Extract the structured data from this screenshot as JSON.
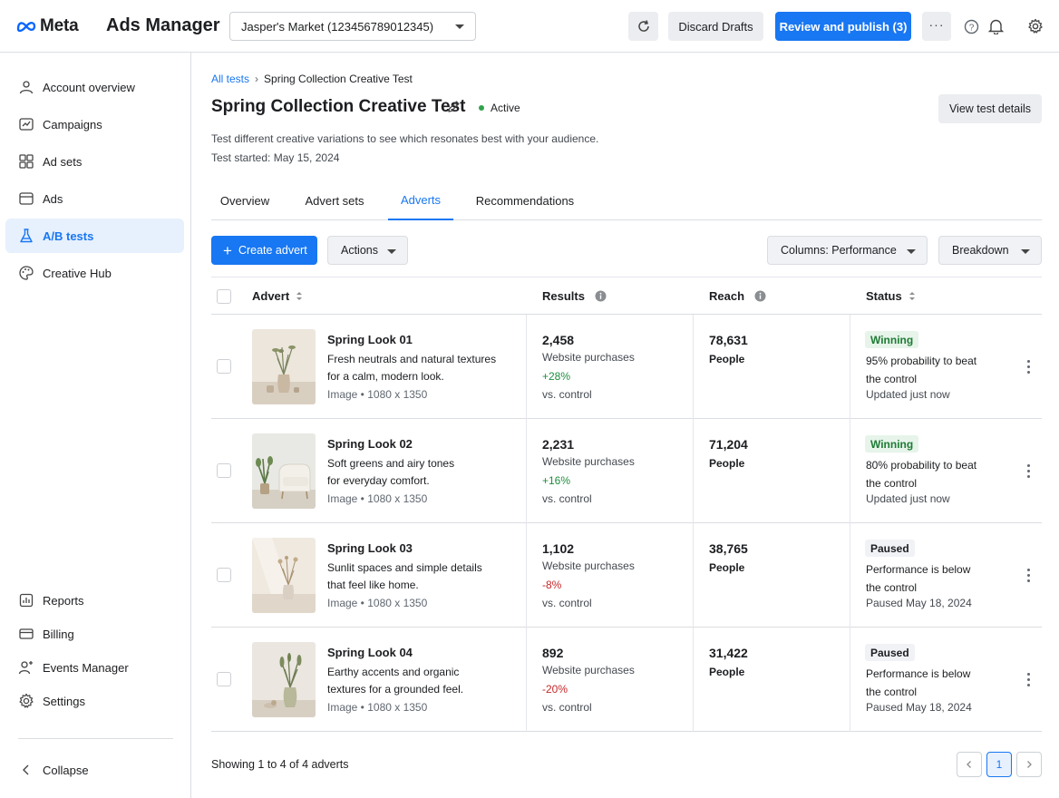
{
  "header": {
    "brand": "Meta",
    "app_title": "Ads Manager",
    "account": "Jasper's Market (123456789012345)",
    "discard_label": "Discard Drafts",
    "publish_label": "Review and publish (3)"
  },
  "sidebar": {
    "items": [
      {
        "label": "Account overview",
        "icon": "account-overview-icon"
      },
      {
        "label": "Campaigns",
        "icon": "campaigns-icon"
      },
      {
        "label": "Ad sets",
        "icon": "ad-sets-icon"
      },
      {
        "label": "Ads",
        "icon": "ads-icon"
      },
      {
        "label": "A/B tests",
        "icon": "flask-icon",
        "active": true
      },
      {
        "label": "Creative Hub",
        "icon": "palette-icon"
      }
    ],
    "bottom_items": [
      {
        "label": "Reports",
        "icon": "reports-icon"
      },
      {
        "label": "Billing",
        "icon": "billing-icon"
      },
      {
        "label": "Events Manager",
        "icon": "events-icon"
      },
      {
        "label": "Settings",
        "icon": "gear-icon"
      }
    ],
    "collapse_label": "Collapse"
  },
  "breadcrumb": {
    "parent": "All tests",
    "current": "Spring Collection Creative Test"
  },
  "page": {
    "title": "Spring Collection Creative Test",
    "status": "Active",
    "view_details_label": "View test details",
    "description": "Test different creative variations to see which resonates best with your audience.",
    "started": "Test started: May 15, 2024"
  },
  "tabs": [
    "Overview",
    "Advert sets",
    "Adverts",
    "Recommendations"
  ],
  "active_tab": "Adverts",
  "toolbar": {
    "create_label": "Create advert",
    "actions_label": "Actions",
    "columns_label": "Columns: Performance",
    "breakdown_label": "Breakdown"
  },
  "table": {
    "columns": [
      "Advert",
      "Results",
      "Reach",
      "Status"
    ],
    "rows": [
      {
        "name": "Spring Look 01",
        "desc1": "Fresh neutrals and natural textures",
        "desc2": "for a calm, modern look.",
        "meta": "Image • 1080 x 1350",
        "results": "2,458",
        "results_label": "Website purchases",
        "delta": "+28%",
        "vs": "vs. control",
        "reach": "78,631",
        "reach_label": "People",
        "status": "Winning",
        "status_line1": "95% probability to beat",
        "status_line2": "the control",
        "status_time": "Updated just now"
      },
      {
        "name": "Spring Look 02",
        "desc1": "Soft greens and airy tones",
        "desc2": "for everyday comfort.",
        "meta": "Image • 1080 x 1350",
        "results": "2,231",
        "results_label": "Website purchases",
        "delta": "+16%",
        "vs": "vs. control",
        "reach": "71,204",
        "reach_label": "People",
        "status": "Winning",
        "status_line1": "80% probability to beat",
        "status_line2": "the control",
        "status_time": "Updated just now"
      },
      {
        "name": "Spring Look 03",
        "desc1": "Sunlit spaces and simple details",
        "desc2": "that feel like home.",
        "meta": "Image • 1080 x 1350",
        "results": "1,102",
        "results_label": "Website purchases",
        "delta": "-8%",
        "vs": "vs. control",
        "reach": "38,765",
        "reach_label": "People",
        "status": "Paused",
        "status_line1": "Performance is below",
        "status_line2": "the control",
        "status_time": "Paused May 18, 2024"
      },
      {
        "name": "Spring Look 04",
        "desc1": "Earthy accents and organic",
        "desc2": "textures for a grounded feel.",
        "meta": "Image • 1080 x 1350",
        "results": "892",
        "results_label": "Website purchases",
        "delta": "-20%",
        "vs": "vs. control",
        "reach": "31,422",
        "reach_label": "People",
        "status": "Paused",
        "status_line1": "Performance is below",
        "status_line2": "the control",
        "status_time": "Paused May 18, 2024"
      }
    ]
  },
  "footer": {
    "summary": "Showing 1 to 4 of 4 adverts",
    "page": "1"
  },
  "colors": {
    "accent": "#1877f2",
    "positive": "#1e8e3e",
    "negative": "#c62828"
  }
}
